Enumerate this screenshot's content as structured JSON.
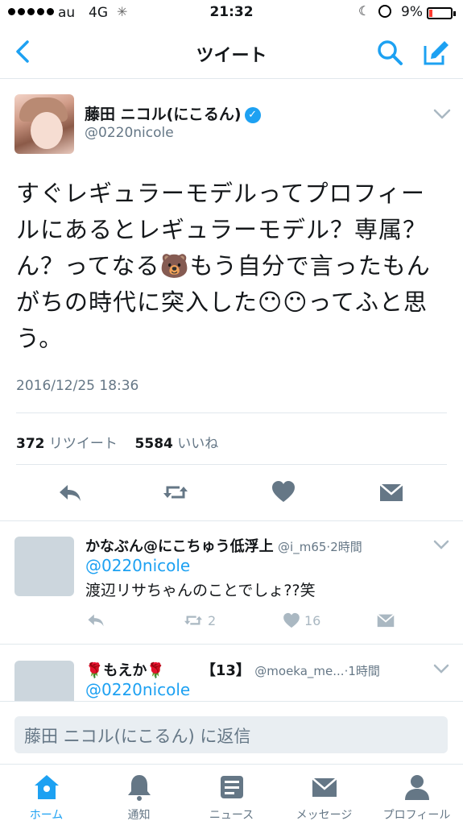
{
  "status_bar": {
    "carrier": "au",
    "network": "4G",
    "time": "21:32",
    "battery": "9%"
  },
  "nav": {
    "title": "ツイート"
  },
  "tweet": {
    "author_name": "藤田 ニコル(にこるん)",
    "author_handle": "@0220nicole",
    "lines": [
      "すぐレギュラーモデルってプロフィー",
      "ルにあるとレギュラーモデル？専属？",
      "ん？ってなる🐻もう自分で言ったもん",
      "がちの時代に突入した😶😶ってふと思",
      "う。"
    ],
    "timestamp": "2016/12/25 18:36",
    "retweet_count": "372",
    "retweet_label": "リツイート",
    "like_count": "5584",
    "like_label": "いいね"
  },
  "replies": [
    {
      "name": "かなぶん@にこちゅう低浮上",
      "handle": "@i_m65",
      "time": "2時間",
      "mention": "@0220nicole",
      "text": "渡辺リサちゃんのことでしょ??笑",
      "retweets": "2",
      "likes": "16"
    },
    {
      "name": "🌹もえか🌹　　　【13】",
      "handle": "@moeka_me...",
      "time": "1時間",
      "mention": "@0220nicole",
      "text": ""
    }
  ],
  "reply_bar": {
    "placeholder": "藤田 ニコル(にこるん) に返信"
  },
  "tabs": [
    {
      "label": "ホーム",
      "icon": "home-icon",
      "active": true
    },
    {
      "label": "通知",
      "icon": "bell-icon"
    },
    {
      "label": "ニュース",
      "icon": "news-icon"
    },
    {
      "label": "メッセージ",
      "icon": "envelope-icon"
    },
    {
      "label": "プロフィール",
      "icon": "person-icon"
    }
  ],
  "colors": {
    "accent": "#1da1f2",
    "muted": "#657786",
    "icon_gray": "#aab8c2",
    "text": "#14171a"
  }
}
